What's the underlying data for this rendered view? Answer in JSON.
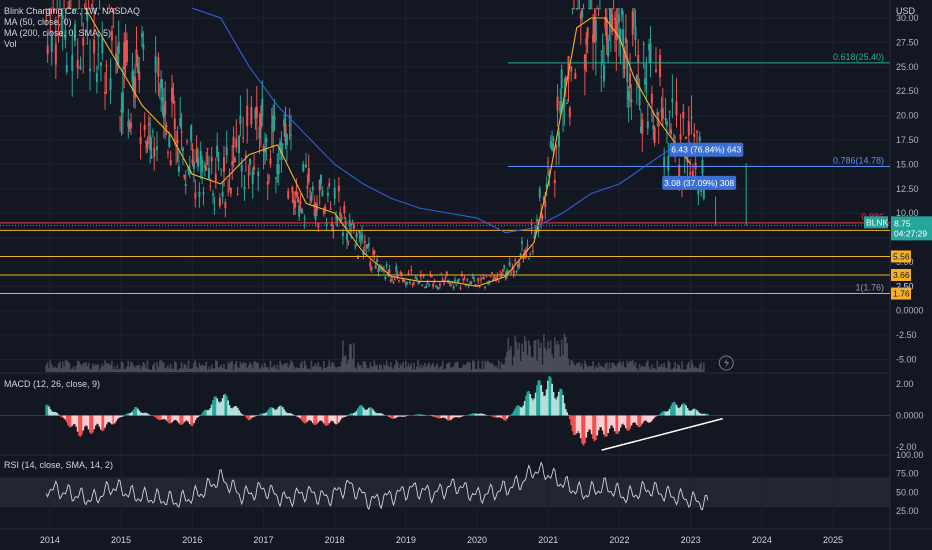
{
  "chart_data": {
    "type": "candlestick",
    "title": "Blink Charging Co., 1W, NASDAQ",
    "currency": "USD",
    "x_ticks": [
      "2014",
      "2015",
      "2016",
      "2017",
      "2018",
      "2019",
      "2020",
      "2021",
      "2022",
      "2023",
      "2024",
      "2025"
    ],
    "price_axis": {
      "ticks": [
        "30.00",
        "27.50",
        "25.00",
        "22.50",
        "20.00",
        "17.50",
        "15.00",
        "12.50",
        "10.00",
        "7.50",
        "5.00",
        "2.50",
        "0.0000",
        "-2.50",
        "-5.00"
      ],
      "ylim": [
        -6,
        31
      ]
    },
    "series": [
      {
        "name": "MA (50, close, 0)",
        "color": "#f5b027",
        "x": [
          2014.5,
          2014.9,
          2015.3,
          2015.7,
          2016.0,
          2016.4,
          2016.8,
          2017.2,
          2017.6,
          2018.0,
          2018.4,
          2018.8,
          2019.2,
          2019.6,
          2020.0,
          2020.4,
          2020.8,
          2021.0,
          2021.2,
          2021.4,
          2021.6,
          2021.8,
          2022.0,
          2022.2,
          2022.5,
          2022.8,
          2023.0
        ],
        "values": [
          31,
          26,
          21,
          18,
          14,
          13,
          16,
          17,
          11,
          10,
          6,
          3.5,
          3,
          3,
          2.5,
          3.5,
          7,
          13,
          21,
          29,
          30,
          30,
          28,
          24,
          20,
          17,
          15
        ]
      },
      {
        "name": "MA (200, close, 0, SMA, 5)",
        "color": "#2f5fd8",
        "x": [
          2016.0,
          2016.4,
          2016.8,
          2017.2,
          2017.6,
          2018.0,
          2018.4,
          2018.8,
          2019.2,
          2019.6,
          2020.0,
          2020.4,
          2020.8,
          2021.2,
          2021.6,
          2022.0,
          2022.4,
          2022.7,
          2023.0
        ],
        "values": [
          36,
          30,
          25,
          21,
          18,
          15,
          13,
          11.5,
          10.5,
          10,
          9.5,
          8,
          8.5,
          10,
          12,
          13,
          15,
          16.5,
          17.3
        ]
      }
    ],
    "volume_label": "Vol",
    "last_price": {
      "symbol": "BLNK",
      "price": "8.75",
      "countdown": "04:27:29",
      "value": 8.75
    },
    "fib_levels": [
      {
        "label": "0.618(25.40)",
        "value": 25.4,
        "color": "#22ab94"
      },
      {
        "label": "0.786(14.78)",
        "value": 14.78,
        "color": "#5b8ef0"
      },
      {
        "label": "0.886",
        "value": 9.0,
        "color": "#f23645"
      },
      {
        "label": "1(1.76)",
        "value": 1.76,
        "color": "#9598a1"
      }
    ],
    "support_lines": [
      {
        "label": "8.23",
        "value": 8.23
      },
      {
        "label": "5.56",
        "value": 5.56
      },
      {
        "label": "3.66",
        "value": 3.66
      },
      {
        "label": "1.76",
        "value": 1.76
      }
    ],
    "extra_tick": "2.50",
    "annotations": [
      {
        "text": "6.43 (76.84%) 643"
      },
      {
        "text": "3.08 (37.09%) 308"
      }
    ],
    "macd": {
      "title": "MACD (12, 26, close, 9)",
      "ticks": [
        "2.00",
        "0.0000",
        "-2.00"
      ],
      "ylim": [
        -2.5,
        2.8
      ],
      "x": [
        2014.0,
        2014.4,
        2014.8,
        2015.2,
        2015.6,
        2016.0,
        2016.4,
        2016.8,
        2017.2,
        2017.6,
        2018.0,
        2018.4,
        2018.8,
        2019.2,
        2019.6,
        2020.0,
        2020.4,
        2020.8,
        2021.0,
        2021.2,
        2021.4,
        2021.6,
        2021.8,
        2022.0,
        2022.4,
        2022.8,
        2023.2
      ],
      "values": [
        0.6,
        -1.2,
        -0.8,
        0.5,
        -0.4,
        -0.6,
        1.5,
        -0.3,
        0.7,
        -0.5,
        -0.6,
        0.7,
        -0.2,
        0.1,
        -0.3,
        0.2,
        -0.3,
        1.8,
        2.3,
        1.4,
        -1.8,
        -1.5,
        -1.2,
        -1.0,
        -0.5,
        0.9,
        0.1
      ]
    },
    "rsi": {
      "title": "RSI (14, close, SMA, 14, 2)",
      "ticks": [
        "100.00",
        "75.00",
        "50.00",
        "25.00"
      ],
      "ylim": [
        20,
        100
      ],
      "band": [
        30,
        70
      ],
      "x": [
        2014.0,
        2014.3,
        2014.6,
        2014.9,
        2015.2,
        2015.5,
        2015.8,
        2016.1,
        2016.4,
        2016.7,
        2017.0,
        2017.3,
        2017.6,
        2017.9,
        2018.2,
        2018.5,
        2018.8,
        2019.1,
        2019.4,
        2019.7,
        2020.0,
        2020.3,
        2020.6,
        2020.8,
        2021.0,
        2021.2,
        2021.5,
        2021.8,
        2022.1,
        2022.4,
        2022.7,
        2023.0,
        2023.2
      ],
      "values": [
        55,
        48,
        40,
        58,
        45,
        42,
        38,
        48,
        70,
        45,
        55,
        40,
        50,
        42,
        60,
        38,
        45,
        55,
        48,
        60,
        45,
        52,
        62,
        80,
        75,
        62,
        48,
        58,
        44,
        55,
        46,
        40,
        36
      ]
    }
  },
  "drawings": {
    "trendline": "macd-divergence-line"
  },
  "colors": {
    "background": "#131722",
    "up": "#26a69a",
    "down": "#ef5350",
    "ma50": "#f5b027",
    "ma200": "#2f5fd8",
    "support": "#f5b027"
  }
}
